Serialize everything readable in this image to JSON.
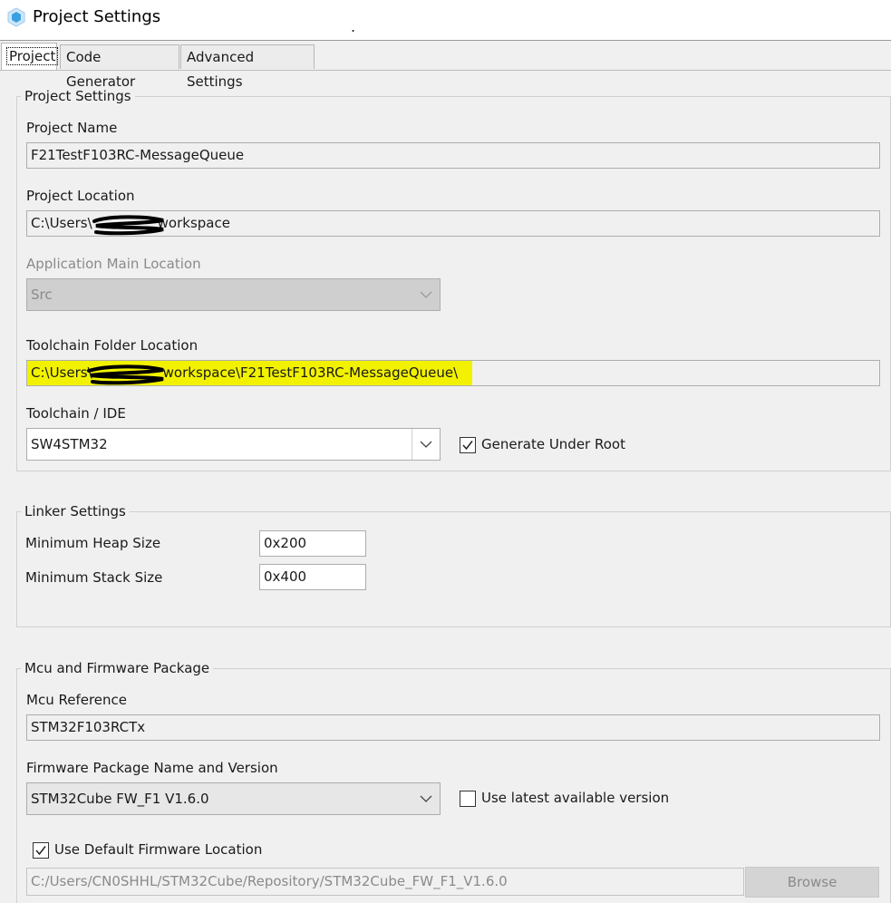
{
  "window": {
    "title": "Project Settings",
    "title_mark": "."
  },
  "tabs": [
    {
      "label": "Project"
    },
    {
      "label": "Code Generator"
    },
    {
      "label": "Advanced Settings"
    }
  ],
  "project_settings": {
    "group_label": "Project Settings",
    "project_name_label": "Project Name",
    "project_name_value": "F21TestF103RC-MessageQueue",
    "project_location_label": "Project Location",
    "project_location_prefix": "C:\\Users\\",
    "project_location_suffix": "workspace",
    "app_main_location_label": "Application Main Location",
    "app_main_location_value": "Src",
    "toolchain_folder_label": "Toolchain Folder Location",
    "toolchain_folder_prefix": "C:\\Users\\",
    "toolchain_folder_suffix": "workspace\\F21TestF103RC-MessageQueue\\",
    "toolchain_ide_label": "Toolchain / IDE",
    "toolchain_ide_value": "SW4STM32",
    "generate_under_root_label": "Generate Under Root",
    "generate_under_root_checked": true
  },
  "linker_settings": {
    "group_label": "Linker Settings",
    "min_heap_label": "Minimum Heap Size",
    "min_heap_value": "0x200",
    "min_stack_label": "Minimum Stack Size",
    "min_stack_value": "0x400"
  },
  "mcu_firmware": {
    "group_label": "Mcu and Firmware Package",
    "mcu_reference_label": "Mcu Reference",
    "mcu_reference_value": "STM32F103RCTx",
    "firmware_package_label": "Firmware Package Name and Version",
    "firmware_package_value": "STM32Cube FW_F1 V1.6.0",
    "use_latest_label": "Use latest available version",
    "use_latest_checked": false,
    "use_default_location_label": "Use Default Firmware Location",
    "use_default_location_checked": true,
    "firmware_location_value": "C:/Users/CN0SHHL/STM32Cube/Repository/STM32Cube_FW_F1_V1.6.0",
    "browse_label": "Browse"
  },
  "colors": {
    "highlight": "#f2f200",
    "icon_blue": "#3a9fe0",
    "window_bg": "#f0f0f0"
  },
  "icons": {
    "app": "cube-icon",
    "dropdown": "chevron-down-icon",
    "check": "checkmark-icon"
  }
}
